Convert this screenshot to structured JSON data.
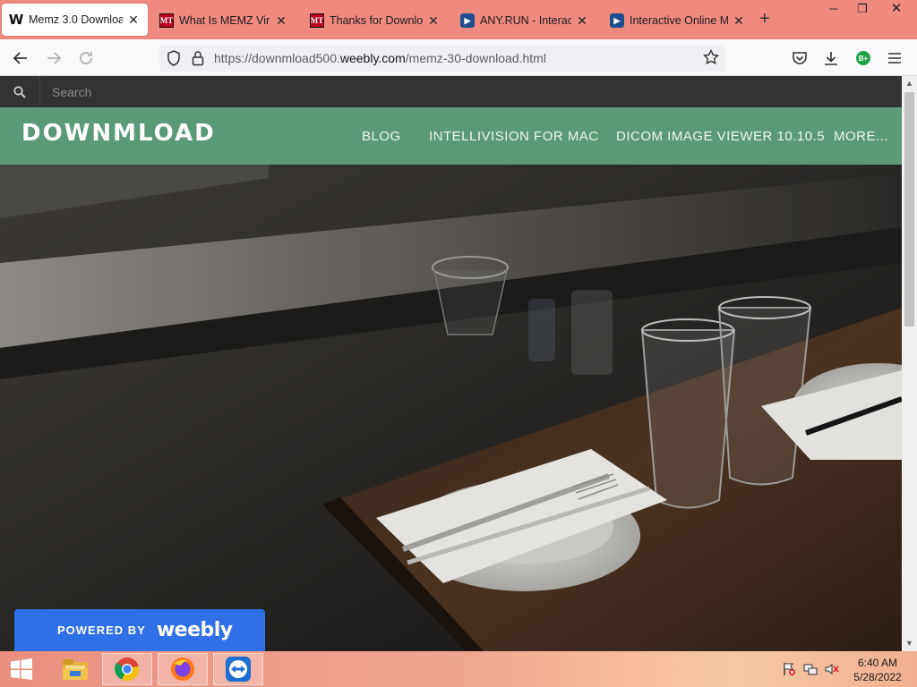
{
  "browser": {
    "tabs": [
      {
        "title": "Memz 3.0 Download",
        "favicon": "weebly-w-icon",
        "active": true
      },
      {
        "title": "What Is MEMZ Virus",
        "favicon": "mt-icon",
        "active": false
      },
      {
        "title": "Thanks for Download",
        "favicon": "mt-icon",
        "active": false
      },
      {
        "title": "ANY.RUN - Interactive",
        "favicon": "anyrun-icon",
        "active": false
      },
      {
        "title": "Interactive Online Ma",
        "favicon": "anyrun-icon",
        "active": false
      }
    ],
    "new_tab_label": "+",
    "url_prefix": "https://downmload500.",
    "url_domain": "weebly.com",
    "url_path": "/memz-30-download.html",
    "extension_badge": "B+"
  },
  "site": {
    "search_placeholder": "Search",
    "logo": "DOWNMLOAD",
    "menu": [
      "BLOG",
      "INTELLIVISION FOR MAC",
      "DICOM IMAGE VIEWER 10.10.5",
      "MORE..."
    ],
    "badge": {
      "powered_by": "POWERED BY",
      "brand": "weebly"
    },
    "colors": {
      "header": "#5a9a78",
      "search": "#333335",
      "badge": "#2f6fe8"
    }
  },
  "taskbar": {
    "time": "6:40 AM",
    "date": "5/28/2022",
    "apps": [
      "start-icon",
      "file-explorer-icon",
      "chrome-icon",
      "firefox-icon",
      "teamviewer-icon"
    ]
  }
}
